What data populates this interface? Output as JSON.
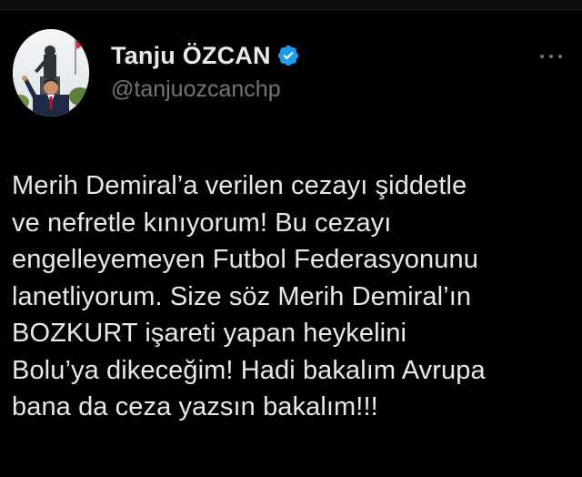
{
  "tweet": {
    "author": {
      "display_name": "Tanju ÖZCAN",
      "handle": "@tanjuozcanchp",
      "verified": true,
      "avatar": "avatar-photo"
    },
    "text_lines": [
      "Merih Demiral’a verilen cezayı şiddetle",
      "ve nefretle kınıyorum! Bu cezayı",
      "engelleyemeyen Futbol Federasyonunu",
      "lanetliyorum. Size söz Merih Demiral’ın",
      "BOZKURT işareti yapan heykelini",
      "Bolu’ya dikeceğim! Hadi bakalım Avrupa",
      "bana da ceza yazsın bakalım!!!"
    ],
    "icons": {
      "verified": "verified-badge-icon",
      "more": "more-options-icon"
    }
  },
  "colors": {
    "background": "#000000",
    "text_primary": "#e7e9ea",
    "text_secondary": "#71767b",
    "verified_blue": "#1d9bf0"
  }
}
